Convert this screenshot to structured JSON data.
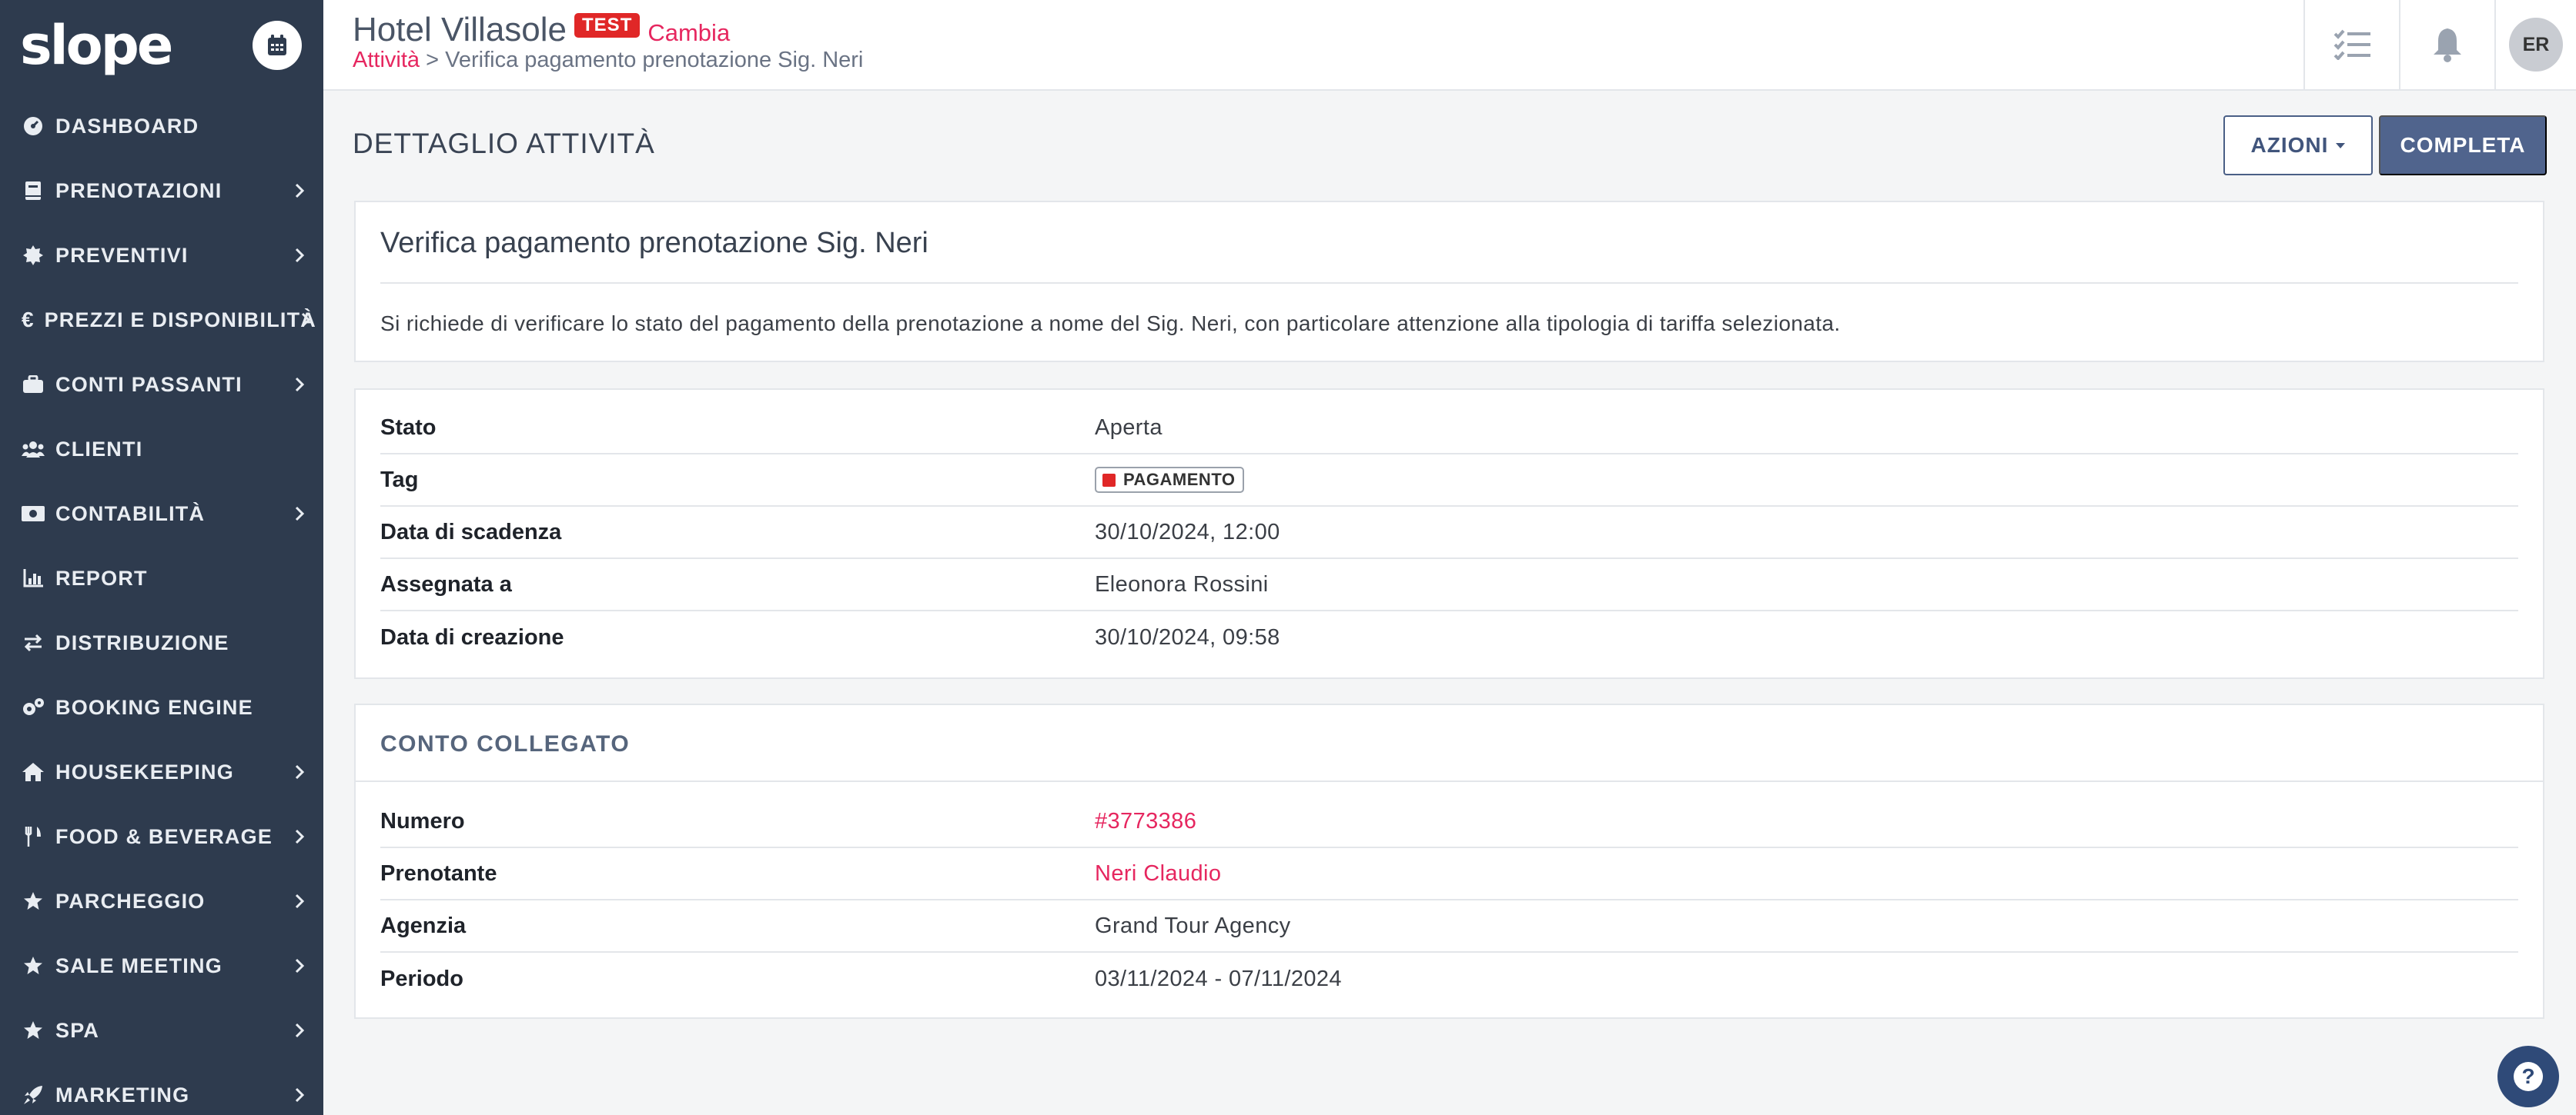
{
  "app": {
    "logo": "slope"
  },
  "colors": {
    "sidebar_bg": "#2e3b4e",
    "accent": "#e6265f",
    "primary": "#50648d",
    "test_badge": "#e02727",
    "tag_color": "#e02727"
  },
  "sidebar": {
    "items": [
      {
        "label": "DASHBOARD",
        "icon": "dashboard-gauge-icon",
        "chevron": false
      },
      {
        "label": "PRENOTAZIONI",
        "icon": "book-icon",
        "chevron": true
      },
      {
        "label": "PREVENTIVI",
        "icon": "badge-icon",
        "chevron": true
      },
      {
        "label": "PREZZI E DISPONIBILITÀ",
        "icon": "euro-icon",
        "chevron": true
      },
      {
        "label": "CONTI PASSANTI",
        "icon": "briefcase-icon",
        "chevron": true
      },
      {
        "label": "CLIENTI",
        "icon": "users-icon",
        "chevron": false
      },
      {
        "label": "CONTABILITÀ",
        "icon": "money-icon",
        "chevron": true
      },
      {
        "label": "REPORT",
        "icon": "chart-icon",
        "chevron": false
      },
      {
        "label": "DISTRIBUZIONE",
        "icon": "exchange-icon",
        "chevron": false
      },
      {
        "label": "BOOKING ENGINE",
        "icon": "cogs-icon",
        "chevron": false
      },
      {
        "label": "HOUSEKEEPING",
        "icon": "home-icon",
        "chevron": true
      },
      {
        "label": "FOOD & BEVERAGE",
        "icon": "utensils-icon",
        "chevron": true
      },
      {
        "label": "PARCHEGGIO",
        "icon": "star-icon",
        "chevron": true
      },
      {
        "label": "SALE MEETING",
        "icon": "star-icon",
        "chevron": true
      },
      {
        "label": "SPA",
        "icon": "star-icon",
        "chevron": true
      },
      {
        "label": "MARKETING",
        "icon": "rocket-icon",
        "chevron": true
      }
    ]
  },
  "header": {
    "hotel_name": "Hotel Villasole",
    "test_badge": "TEST",
    "change_label": "Cambia",
    "breadcrumb_link": "Attività",
    "breadcrumb_sep": ">",
    "breadcrumb_current": "Verifica pagamento prenotazione Sig. Neri",
    "avatar_initials": "ER"
  },
  "page": {
    "title": "DETTAGLIO ATTIVITÀ",
    "actions_label": "AZIONI",
    "complete_label": "COMPLETA"
  },
  "task": {
    "title": "Verifica pagamento prenotazione Sig. Neri",
    "description": "Si richiede di verificare lo stato del pagamento della prenotazione a nome del Sig. Neri, con particolare attenzione alla tipologia di tariffa selezionata."
  },
  "details": {
    "rows": [
      {
        "label": "Stato",
        "value": "Aperta"
      },
      {
        "label": "Tag",
        "value": "PAGAMENTO"
      },
      {
        "label": "Data di scadenza",
        "value": "30/10/2024, 12:00"
      },
      {
        "label": "Assegnata a",
        "value": "Eleonora Rossini"
      },
      {
        "label": "Data di creazione",
        "value": "30/10/2024, 09:58"
      }
    ]
  },
  "linked_account": {
    "heading": "CONTO COLLEGATO",
    "rows": [
      {
        "label": "Numero",
        "value": "#3773386"
      },
      {
        "label": "Prenotante",
        "value": "Neri Claudio"
      },
      {
        "label": "Agenzia",
        "value": "Grand Tour Agency"
      },
      {
        "label": "Periodo",
        "value": "03/11/2024 - 07/11/2024"
      }
    ]
  }
}
